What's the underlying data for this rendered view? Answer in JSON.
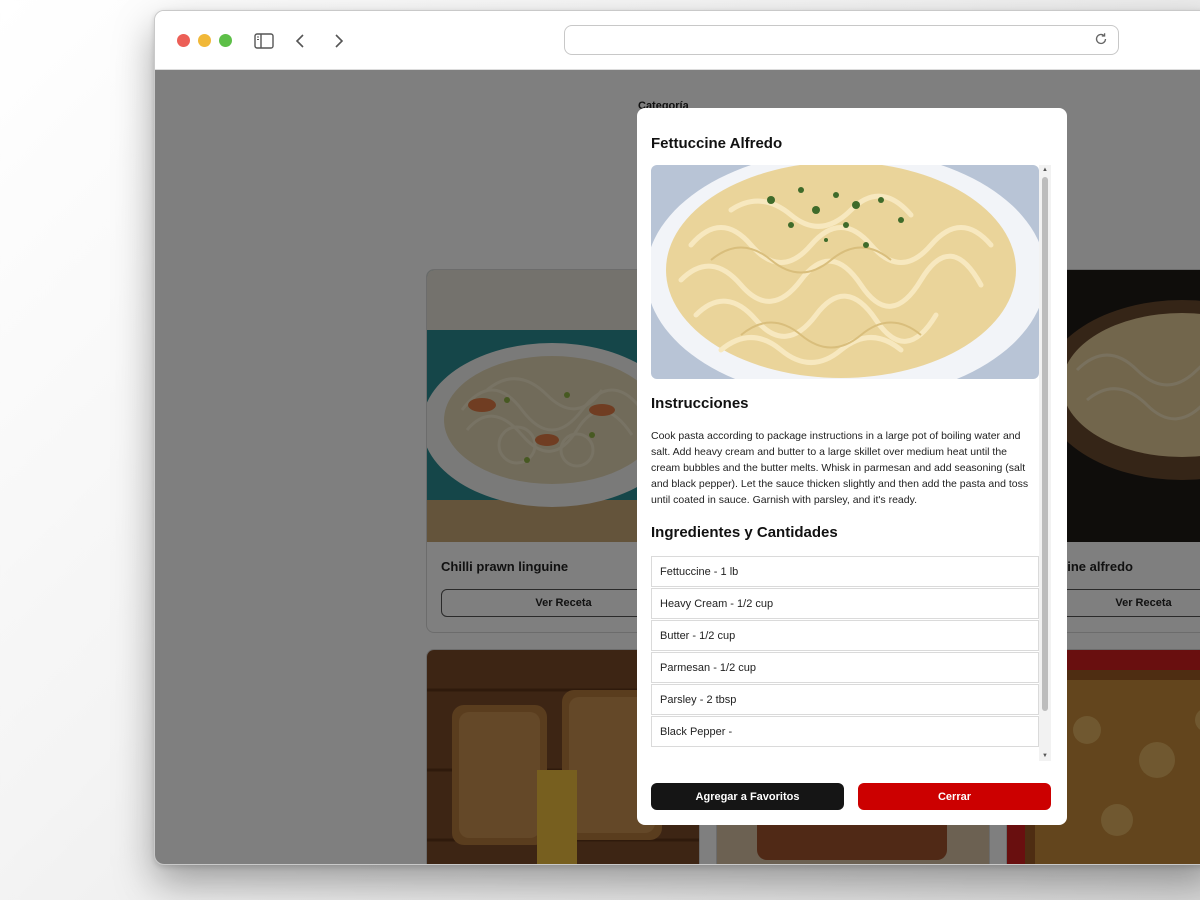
{
  "page": {
    "category_label": "Categoría"
  },
  "cards": [
    {
      "title": "Chilli prawn linguine",
      "button": "Ver Receta",
      "image": "prawn-linguine-photo"
    },
    {
      "title": "Fettuccine alfredo",
      "button": "Ver Receta",
      "image": "fettuccine-alfredo-photo"
    },
    {
      "title": "",
      "button": "",
      "image": "grilled-cheese-photo"
    },
    {
      "title": "",
      "button": "",
      "image": "sandwich-photo"
    },
    {
      "title": "",
      "button": "",
      "image": "lasagna-photo"
    }
  ],
  "modal": {
    "title": "Fettuccine Alfredo",
    "image": "fettuccine-alfredo-photo",
    "instructions_heading": "Instrucciones",
    "instructions": "Cook pasta according to package instructions in a large pot of boiling water and salt. Add heavy cream and butter to a large skillet over medium heat until the cream bubbles and the butter melts. Whisk in parmesan and add seasoning (salt and black pepper). Let the sauce thicken slightly and then add the pasta and toss until coated in sauce. Garnish with parsley, and it's ready.",
    "ingredients_heading": "Ingredientes y Cantidades",
    "ingredients": [
      "Fettuccine - 1 lb",
      "Heavy Cream - 1/2 cup",
      "Butter - 1/2 cup",
      "Parmesan - 1/2 cup",
      "Parsley - 2 tbsp",
      "Black Pepper -"
    ],
    "favorite_button": "Agregar a Favoritos",
    "close_button": "Cerrar"
  },
  "colors": {
    "primary_dark": "#151515",
    "accent_red": "#cc0000"
  }
}
